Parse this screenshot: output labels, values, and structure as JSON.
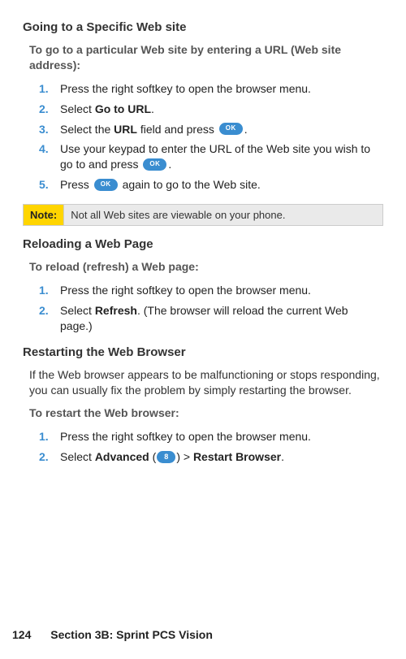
{
  "section1": {
    "heading": "Going to a Specific Web site",
    "intro": "To go to a particular Web site by entering a URL (Web site address):",
    "steps": {
      "s1": "Press the right softkey to open the browser menu.",
      "s2_a": "Select ",
      "s2_b": "Go to URL",
      "s2_c": ".",
      "s3_a": "Select the ",
      "s3_b": "URL",
      "s3_c": " field and press ",
      "s3_d": ".",
      "s4_a": "Use your keypad to enter the URL of the Web site you wish to go to and press ",
      "s4_b": ".",
      "s5_a": "Press ",
      "s5_b": " again to go to the Web site."
    }
  },
  "note": {
    "label": "Note:",
    "content": "Not all Web sites are viewable on your phone."
  },
  "section2": {
    "heading": "Reloading a Web Page",
    "intro": "To reload (refresh) a Web page:",
    "steps": {
      "s1": "Press the right softkey to open the browser menu.",
      "s2_a": "Select ",
      "s2_b": "Refresh",
      "s2_c": ". (The browser will reload the current Web page.)"
    }
  },
  "section3": {
    "heading": "Restarting the Web Browser",
    "body": "If the Web browser appears to be malfunctioning or stops responding, you can usually fix the problem by simply restarting the browser.",
    "intro": "To restart the Web browser:",
    "steps": {
      "s1": "Press the right softkey to open the browser menu.",
      "s2_a": "Select ",
      "s2_b": "Advanced",
      "s2_c": " (",
      "s2_key": "8",
      "s2_d": ") > ",
      "s2_e": "Restart Browser",
      "s2_f": "."
    }
  },
  "footer": {
    "page": "124",
    "section": "Section 3B: Sprint PCS Vision"
  },
  "buttons": {
    "ok": "OK"
  }
}
